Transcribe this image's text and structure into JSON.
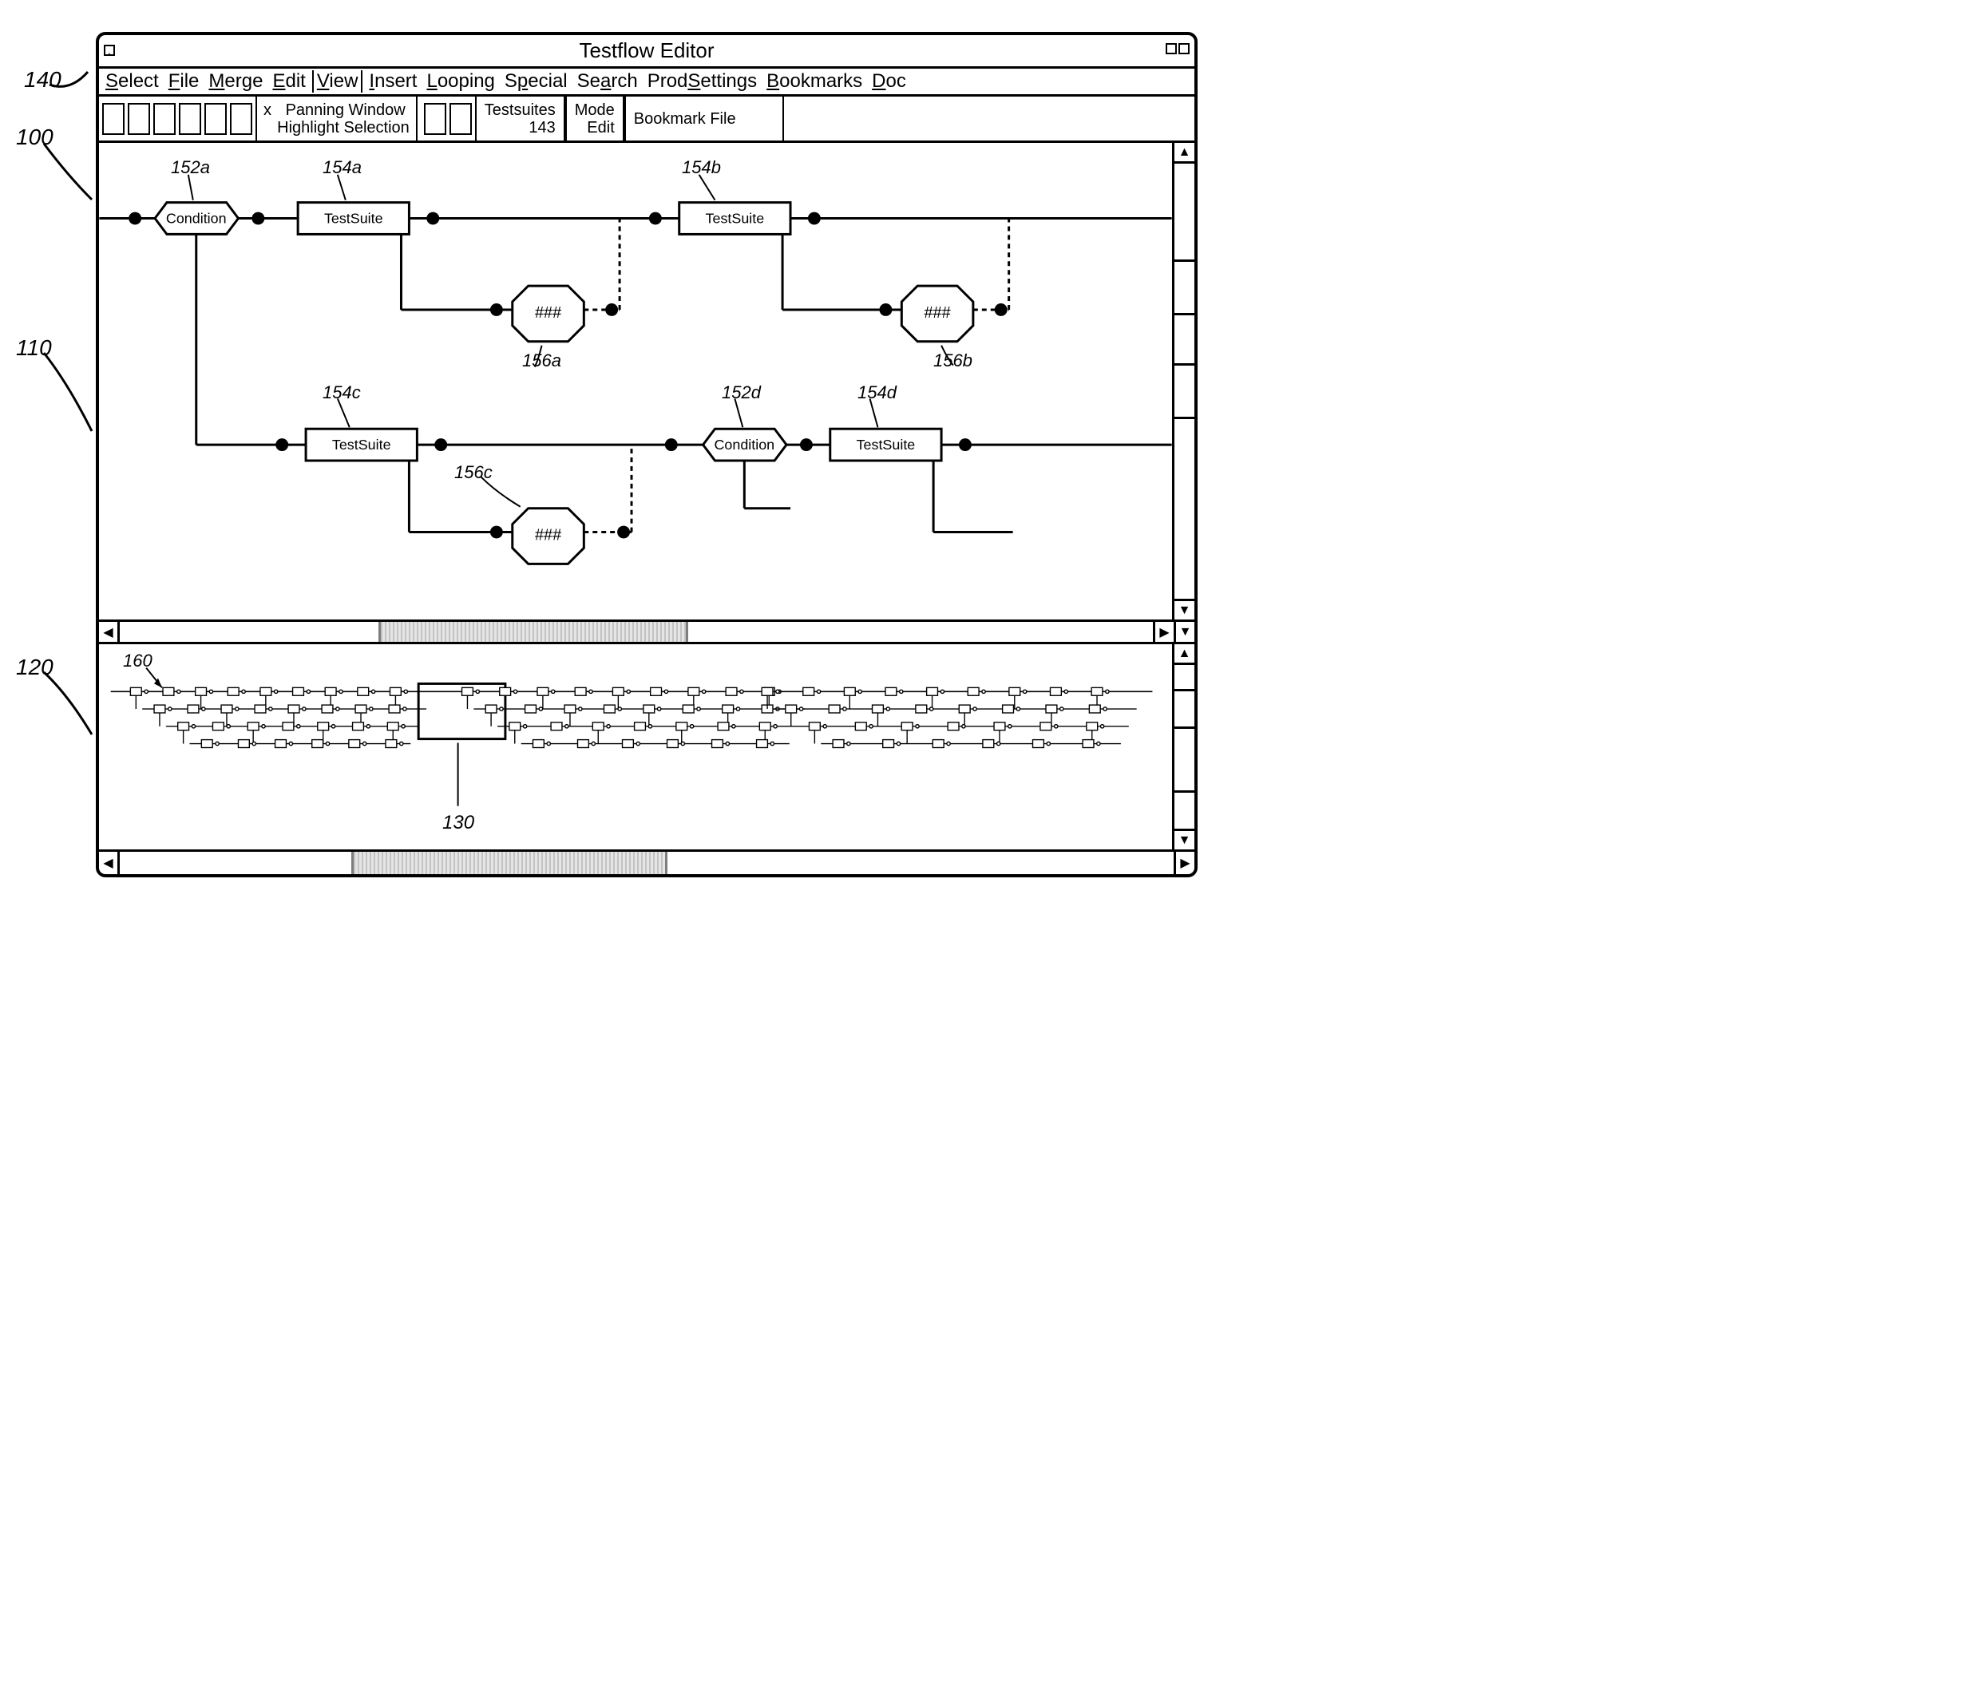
{
  "window": {
    "title": "Testflow Editor"
  },
  "menu": {
    "select": "Select",
    "file": "File",
    "merge": "Merge",
    "edit": "Edit",
    "view": "View",
    "insert": "Insert",
    "looping": "Looping",
    "special": "Special",
    "search": "Search",
    "prodsettings": "ProdSettings",
    "bookmarks": "Bookmarks",
    "doc": "Doc"
  },
  "toolbar": {
    "panning_checked": "x",
    "panning_label": "Panning Window",
    "highlight_label": "Highlight Selection",
    "testsuites_label": "Testsuites",
    "testsuites_value": "143",
    "mode_label": "Mode",
    "mode_value": "Edit",
    "bookmark_label": "Bookmark File"
  },
  "flow": {
    "condition": "Condition",
    "testsuite": "TestSuite",
    "bin": "###"
  },
  "refs": {
    "r140": "140",
    "r100": "100",
    "r110": "110",
    "r120": "120",
    "r152a": "152a",
    "r154a": "154a",
    "r154b": "154b",
    "r156a": "156a",
    "r156b": "156b",
    "r154c": "154c",
    "r152d": "152d",
    "r154d": "154d",
    "r156c": "156c",
    "r160": "160",
    "r130": "130"
  }
}
